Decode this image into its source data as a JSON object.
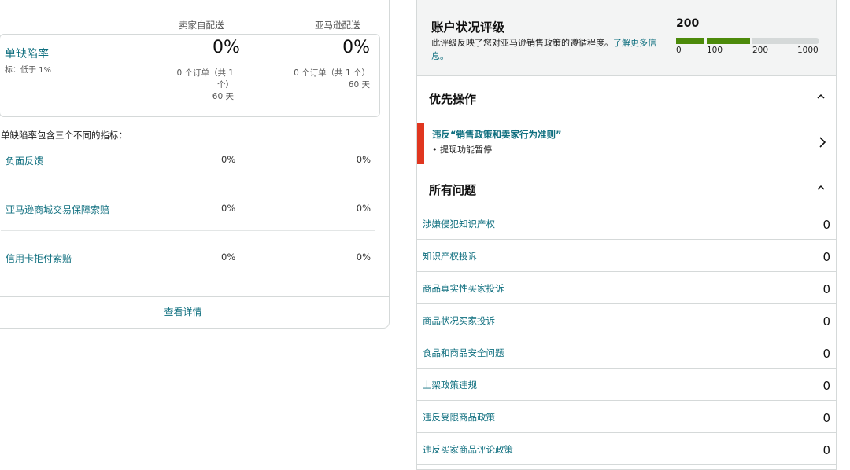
{
  "left": {
    "col_self_ship": "卖家自配送",
    "col_amazon_ship": "亚马逊配送",
    "metric": {
      "title": "单缺陷率",
      "target": "标：低于 1%",
      "self_pct": "0%",
      "self_sub_1": "0 个订单（共 1",
      "self_sub_2": "个）",
      "self_days": "60 天",
      "amz_pct": "0%",
      "amz_sub": "0 个订单（共 1 个）",
      "amz_days": "60 天"
    },
    "intro": "单缺陷率包含三个不同的指标：",
    "sub_metrics": [
      {
        "label": "负面反馈",
        "self": "0%",
        "amazon": "0%"
      },
      {
        "label": "亚马逊商城交易保障索赔",
        "self": "0%",
        "amazon": "0%"
      },
      {
        "label": "信用卡拒付索赔",
        "self": "0%",
        "amazon": "0%"
      }
    ],
    "view_details": "查看详情"
  },
  "rating": {
    "title": "账户状况评级",
    "desc": "此评级反映了您对亚马逊销售政策的遵循程度。",
    "learn_more": "了解更多信息。",
    "score": "200",
    "score_value": 200,
    "ticks": [
      "0",
      "100",
      "200",
      "1000"
    ],
    "colors": {
      "good": "#4c8a0a",
      "empty": "#d5d9d9"
    }
  },
  "priority": {
    "heading": "优先操作",
    "violation_title": "违反“销售政策和卖家行为准则”",
    "violation_sub": "• 提现功能暂停",
    "accent": "#e0361f"
  },
  "issues": {
    "heading": "所有问题",
    "items": [
      {
        "label": "涉嫌侵犯知识产权",
        "count": "0"
      },
      {
        "label": "知识产权投诉",
        "count": "0"
      },
      {
        "label": "商品真实性买家投诉",
        "count": "0"
      },
      {
        "label": "商品状况买家投诉",
        "count": "0"
      },
      {
        "label": "食品和商品安全问题",
        "count": "0"
      },
      {
        "label": "上架政策违规",
        "count": "0"
      },
      {
        "label": "违反受限商品政策",
        "count": "0"
      },
      {
        "label": "违反买家商品评论政策",
        "count": "0"
      }
    ]
  }
}
